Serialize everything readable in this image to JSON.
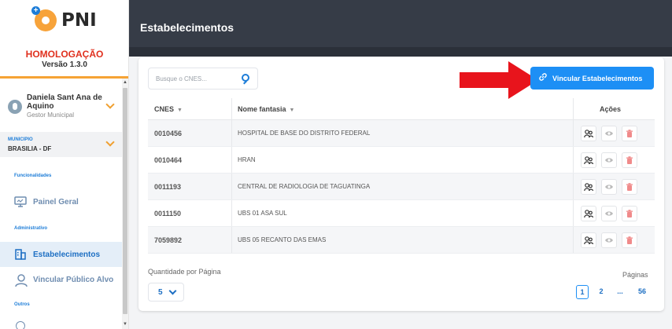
{
  "sidebar": {
    "app_name": "PNI",
    "environment": "HOMOLOGAÇÃO",
    "version": "Versão 1.3.0",
    "user": {
      "name": "Daniela Sant Ana de Aquino",
      "role": "Gestor Municipal"
    },
    "municipio": {
      "label": "MUNICIPIO",
      "value": "BRASILIA - DF"
    },
    "sections": [
      {
        "title": "Funcionalidades",
        "items": [
          {
            "label": "Painel Geral",
            "icon": "monitor-icon"
          }
        ]
      },
      {
        "title": "Administrativo",
        "items": [
          {
            "label": "Estabelecimentos",
            "icon": "buildings-icon",
            "active": true
          },
          {
            "label": "Vincular Público Alvo",
            "icon": "user-icon"
          }
        ]
      },
      {
        "title": "Outros",
        "items": []
      }
    ]
  },
  "header": {
    "title": "Estabelecimentos"
  },
  "toolbar": {
    "search_placeholder": "Busque o CNES...",
    "link_button_label": "Vincular Estabelecimentos"
  },
  "table": {
    "columns": {
      "cnes": "CNES",
      "name": "Nome fantasia",
      "actions": "Ações"
    },
    "rows": [
      {
        "cnes": "0010456",
        "name": "HOSPITAL DE BASE DO DISTRITO FEDERAL"
      },
      {
        "cnes": "0010464",
        "name": "HRAN"
      },
      {
        "cnes": "0011193",
        "name": "CENTRAL DE RADIOLOGIA DE TAGUATINGA"
      },
      {
        "cnes": "0011150",
        "name": "UBS 01 ASA SUL"
      },
      {
        "cnes": "7059892",
        "name": "UBS 05 RECANTO DAS EMAS"
      }
    ]
  },
  "pagination": {
    "per_page_label": "Quantidade por Página",
    "per_page_value": "5",
    "pages_label": "Páginas",
    "pages": [
      "1",
      "2",
      "...",
      "56"
    ]
  },
  "colors": {
    "primary": "#1d8ff5",
    "accent": "#f6a335",
    "header": "#363c47",
    "env": "#e0301e",
    "delete": "#e05555"
  }
}
